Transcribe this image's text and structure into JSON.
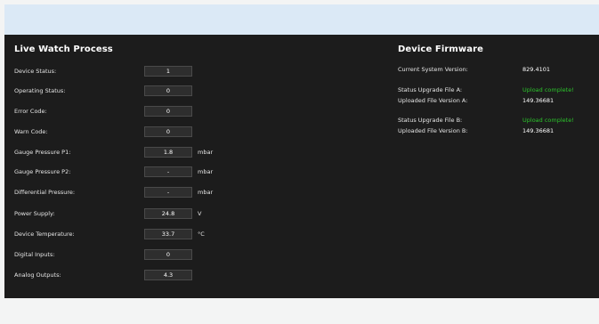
{
  "live_watch": {
    "title": "Live Watch Process",
    "rows": [
      {
        "label": "Device Status:",
        "value": "1",
        "unit": ""
      },
      {
        "label": "Operating Status:",
        "value": "0",
        "unit": ""
      },
      {
        "label": "Error Code:",
        "value": "0",
        "unit": ""
      },
      {
        "label": "Warn Code:",
        "value": "0",
        "unit": ""
      },
      {
        "label": "Gauge Pressure P1:",
        "value": "1.8",
        "unit": "mbar"
      },
      {
        "label": "Gauge Pressure P2:",
        "value": "-",
        "unit": "mbar"
      },
      {
        "label": "Differential Pressure:",
        "value": "-",
        "unit": "mbar"
      },
      {
        "label": "Power Supply:",
        "value": "24.8",
        "unit": "V"
      },
      {
        "label": "Device Temperature:",
        "value": "33.7",
        "unit": "°C"
      },
      {
        "label": "Digital Inputs:",
        "value": "0",
        "unit": ""
      },
      {
        "label": "Analog Outputs:",
        "value": "4.3",
        "unit": ""
      }
    ]
  },
  "firmware": {
    "title": "Device Firmware",
    "current_version_label": "Current System Version:",
    "current_version_value": "829.4101",
    "file_a": {
      "status_label": "Status Upgrade File A:",
      "status_value": "Upload complete!",
      "version_label": "Uploaded File Version A:",
      "version_value": "149.36681"
    },
    "file_b": {
      "status_label": "Status Upgrade File B:",
      "status_value": "Upload complete!",
      "version_label": "Uploaded File Version B:",
      "version_value": "149.36681"
    }
  },
  "colors": {
    "panel_bg": "#1c1c1c",
    "header_bg": "#dbe9f6",
    "page_bg": "#f3f4f4",
    "success": "#2bc42b"
  }
}
